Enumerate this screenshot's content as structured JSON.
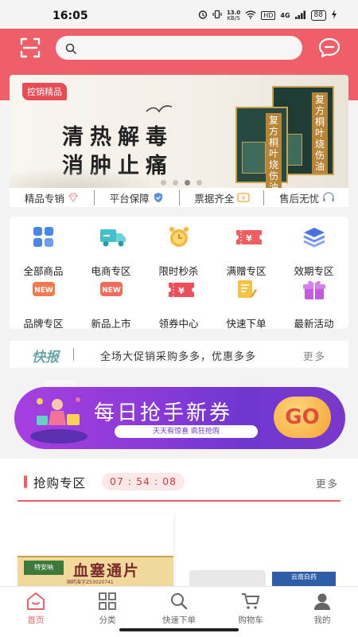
{
  "status_bar": {
    "time": "16:05",
    "network_speed_value": "13.0",
    "network_speed_unit": "KB/S",
    "hd_label": "HD",
    "signal_label": "4G",
    "battery": "88",
    "icons": [
      "alarm-icon",
      "vibrate-icon",
      "wifi-icon",
      "signal-icon",
      "battery-icon",
      "charging-icon"
    ]
  },
  "header": {
    "accent_color": "#ef5f6a",
    "search_placeholder": "",
    "icons": [
      "scan-icon",
      "search-icon",
      "message-icon"
    ]
  },
  "banner": {
    "tag": "控销精品",
    "line1": "清热解毒",
    "line2": "消肿止痛",
    "product_front_title": "复方桐叶烧伤油",
    "product_back_title": "复方桐叶烧伤油",
    "slide_count": 4,
    "active_slide": 3
  },
  "features": [
    {
      "label": "精品专销",
      "icon": "diamond-icon"
    },
    {
      "label": "平台保障",
      "icon": "shield-icon"
    },
    {
      "label": "票据齐全",
      "icon": "invoice-icon"
    },
    {
      "label": "售后无忧",
      "icon": "headset-icon"
    }
  ],
  "categories": [
    {
      "label": "全部商品",
      "icon": "grid-icon"
    },
    {
      "label": "电商专区",
      "icon": "truck-icon"
    },
    {
      "label": "限时秒杀",
      "icon": "alarm-clock-icon"
    },
    {
      "label": "满赠专区",
      "icon": "coupon-icon"
    },
    {
      "label": "效期专区",
      "icon": "layers-icon"
    },
    {
      "label": "品牌专区",
      "icon": "new-badge-icon"
    },
    {
      "label": "新品上市",
      "icon": "new-badge-icon"
    },
    {
      "label": "领券中心",
      "icon": "ticket-icon"
    },
    {
      "label": "快速下单",
      "icon": "edit-order-icon"
    },
    {
      "label": "最新活动",
      "icon": "gift-icon"
    }
  ],
  "news": {
    "title": "快报",
    "text": "全场大促销采购多多，优惠多多",
    "more": "更多"
  },
  "coupon_banner": {
    "text": "每日抢手新券",
    "sub": "天天有惊喜 疯狂抢购",
    "go": "GO",
    "small": "shopping"
  },
  "flash_sale": {
    "title": "抢购专区",
    "timer": "07 : 54 : 08",
    "more": "更多",
    "product1_name": "血塞通片",
    "product1_brand": "特安呐",
    "product1_sub": "国药准字Z53020741",
    "product3_label": "云南白药"
  },
  "tabbar": {
    "active": 0,
    "tabs": [
      {
        "label": "首页",
        "icon": "home-icon"
      },
      {
        "label": "分类",
        "icon": "category-icon"
      },
      {
        "label": "快速下单",
        "icon": "search-icon"
      },
      {
        "label": "购物车",
        "icon": "cart-icon"
      },
      {
        "label": "我的",
        "icon": "user-icon"
      }
    ]
  }
}
